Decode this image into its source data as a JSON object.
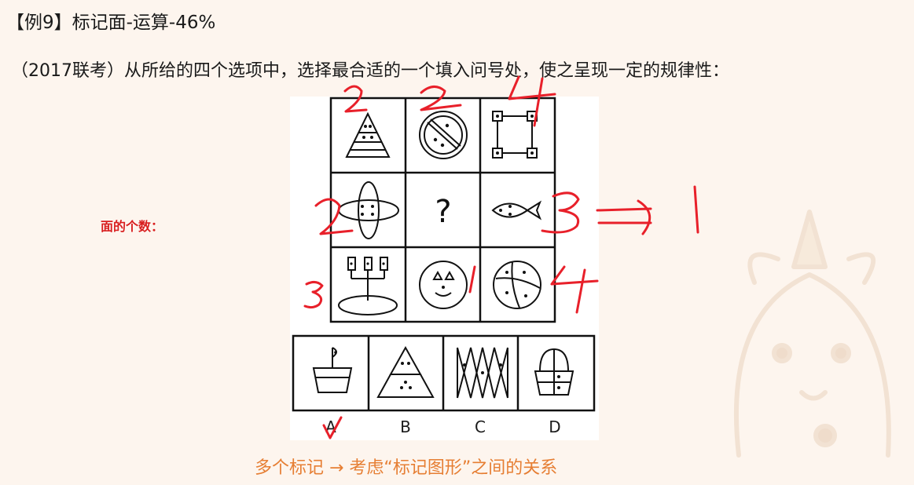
{
  "header": {
    "title": "【例9】标记面-运算-46%"
  },
  "question": {
    "text": "（2017联考）从所给的四个选项中，选择最合适的一个填入问号处，使之呈现一定的规律性："
  },
  "grid": {
    "cells": [
      {
        "figure": "triangle-with-dots"
      },
      {
        "figure": "prohibition-circle-with-dots"
      },
      {
        "figure": "square-with-corner-dots"
      },
      {
        "figure": "cross-ellipses-with-dots"
      },
      {
        "figure": "question-mark",
        "symbol": "?"
      },
      {
        "figure": "fish-with-dots"
      },
      {
        "figure": "candelabra-on-ellipse"
      },
      {
        "figure": "face-circle"
      },
      {
        "figure": "segmented-circle-with-dots"
      }
    ]
  },
  "options": [
    {
      "label": "A",
      "figure": "flag-in-pot"
    },
    {
      "label": "B",
      "figure": "stacked-triangles"
    },
    {
      "label": "C",
      "figure": "zigzag-with-dots"
    },
    {
      "label": "D",
      "figure": "balloon-basket"
    }
  ],
  "annotations": {
    "side_label": "面的个数：",
    "footer": "多个标记 → 考虑“标记图形”之间的关系",
    "handwritten": [
      "2",
      "2",
      "4",
      "2",
      "3",
      "1",
      "3",
      "1",
      "4"
    ],
    "answer_mark": "A",
    "colors": {
      "handwriting": "#e8202a",
      "footer": "#e67e33",
      "side_label": "#d81e1e"
    }
  }
}
